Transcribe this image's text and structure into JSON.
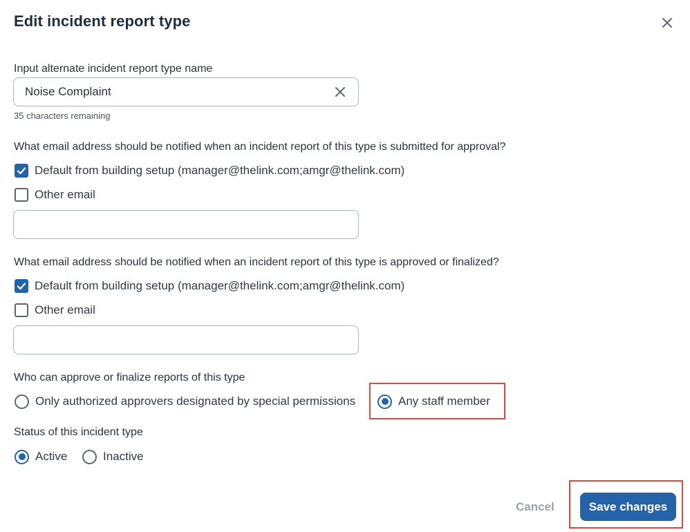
{
  "dialog": {
    "title": "Edit incident report type",
    "close_icon": "close-icon"
  },
  "name_field": {
    "label": "Input alternate incident report type name",
    "value": "Noise Complaint",
    "hint": "35 characters remaining",
    "clear_icon": "clear-icon"
  },
  "submitted_section": {
    "question": "What email address should be notified when an incident report of this type is submitted for approval?",
    "default_option": {
      "label": "Default from building setup (manager@thelink.com;amgr@thelink.com)",
      "checked": true
    },
    "other_option": {
      "label": "Other email",
      "checked": false
    },
    "other_email_value": ""
  },
  "approved_section": {
    "question": "What email address should be notified when an incident report of this type is approved or finalized?",
    "default_option": {
      "label": "Default from building setup (manager@thelink.com;amgr@thelink.com)",
      "checked": true
    },
    "other_option": {
      "label": "Other email",
      "checked": false
    },
    "other_email_value": ""
  },
  "approvers_section": {
    "question": "Who can approve or finalize reports of this type",
    "options": [
      {
        "label": "Only authorized approvers designated by special permissions",
        "selected": false
      },
      {
        "label": "Any staff member",
        "selected": true
      }
    ]
  },
  "status_section": {
    "question": "Status of this incident type",
    "options": [
      {
        "label": "Active",
        "selected": true
      },
      {
        "label": "Inactive",
        "selected": false
      }
    ]
  },
  "footer": {
    "cancel_label": "Cancel",
    "save_label": "Save changes"
  },
  "colors": {
    "accent": "#2463a8",
    "highlight": "#e0463f",
    "title": "#1f2d3d",
    "cancel": "#9aa3ad"
  }
}
